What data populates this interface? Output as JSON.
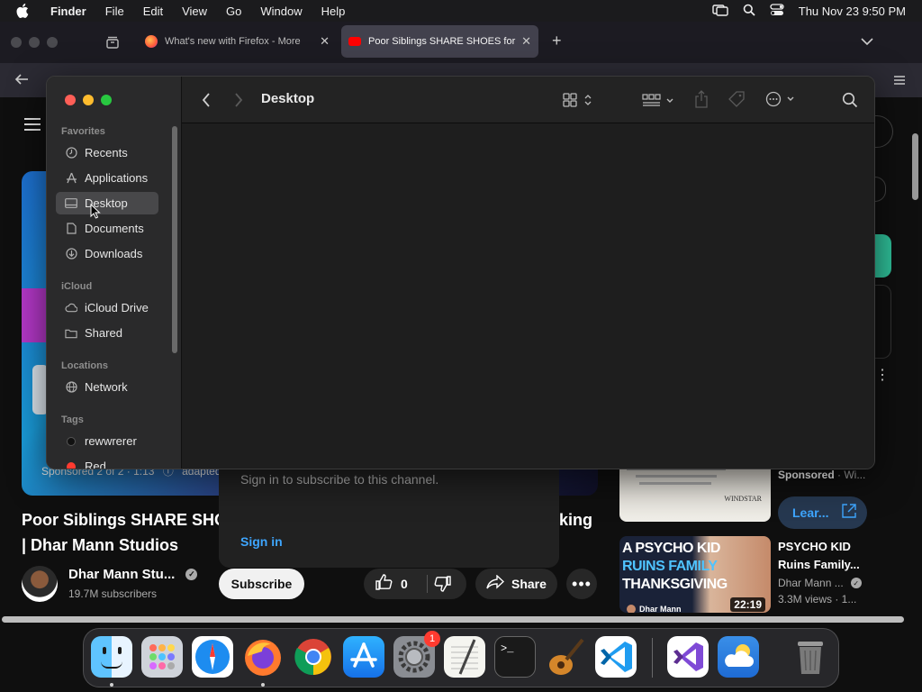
{
  "menubar": {
    "app_name": "Finder",
    "menus": [
      "File",
      "Edit",
      "View",
      "Go",
      "Window",
      "Help"
    ],
    "datetime": "Thu Nov 23  9:50 PM"
  },
  "browser": {
    "tabs": [
      {
        "title": "What's new with Firefox - More",
        "active": false
      },
      {
        "title": "Poor Siblings SHARE SHOES for",
        "active": true
      }
    ]
  },
  "youtube": {
    "sponsored_text": "Sponsored 2 of 2 · 1:13",
    "sponsored_suffix": "adapted",
    "video_title_line1": "Poor Siblings SHARE SHO",
    "video_title_line2": "| Dhar Mann Studios",
    "video_title_tail": "king",
    "channel_name": "Dhar Mann Stu...",
    "subscribers": "19.7M subscribers",
    "subscribe_label": "Subscribe",
    "likes": "0",
    "share_label": "Share",
    "popup_text": "Sign in to subscribe to this channel.",
    "popup_signin": "Sign in",
    "side_sponsored": "Sponsored",
    "side_sponsored_suffix": "· Wi...",
    "learn_label": "Lear...",
    "rec_title_line1": "PSYCHO KID",
    "rec_title_line2": "Ruins Family...",
    "rec_channel": "Dhar Mann ...",
    "rec_meta": "3.3M views · 1...",
    "rec_duration": "22:19",
    "thumb_text_1": "A PSYCHO KID",
    "thumb_text_2": "RUINS FAMILY",
    "thumb_text_3": "THANKSGIVING",
    "thumb_channel": "Dhar Mann",
    "ad_brand": "WINDSTAR"
  },
  "finder": {
    "title": "Desktop",
    "sections": {
      "favorites": "Favorites",
      "icloud": "iCloud",
      "locations": "Locations",
      "tags": "Tags"
    },
    "favorites": [
      {
        "label": "Recents",
        "icon": "clock-icon"
      },
      {
        "label": "Applications",
        "icon": "applications-icon"
      },
      {
        "label": "Desktop",
        "icon": "desktop-icon",
        "selected": true
      },
      {
        "label": "Documents",
        "icon": "document-icon"
      },
      {
        "label": "Downloads",
        "icon": "download-icon"
      }
    ],
    "icloud": [
      {
        "label": "iCloud Drive",
        "icon": "cloud-icon"
      },
      {
        "label": "Shared",
        "icon": "shared-folder-icon"
      }
    ],
    "locations": [
      {
        "label": "Network",
        "icon": "globe-icon"
      }
    ],
    "tags": [
      {
        "label": "rewwrerer",
        "color": "#1a1a1a"
      },
      {
        "label": "Red",
        "color": "#ff3b30"
      }
    ]
  },
  "dock": {
    "apps": [
      "Finder",
      "Launchpad",
      "Safari",
      "Firefox",
      "Chrome",
      "App Store",
      "System Settings",
      "TextEdit",
      "Terminal",
      "GarageBand",
      "Visual Studio Code",
      "Visual Studio",
      "Weather",
      "Trash"
    ],
    "settings_badge": "1"
  },
  "colors": {
    "accent_blue": "#3ea6ff",
    "close": "#ff5f57",
    "minimize": "#febc2e",
    "zoom": "#28c840"
  }
}
